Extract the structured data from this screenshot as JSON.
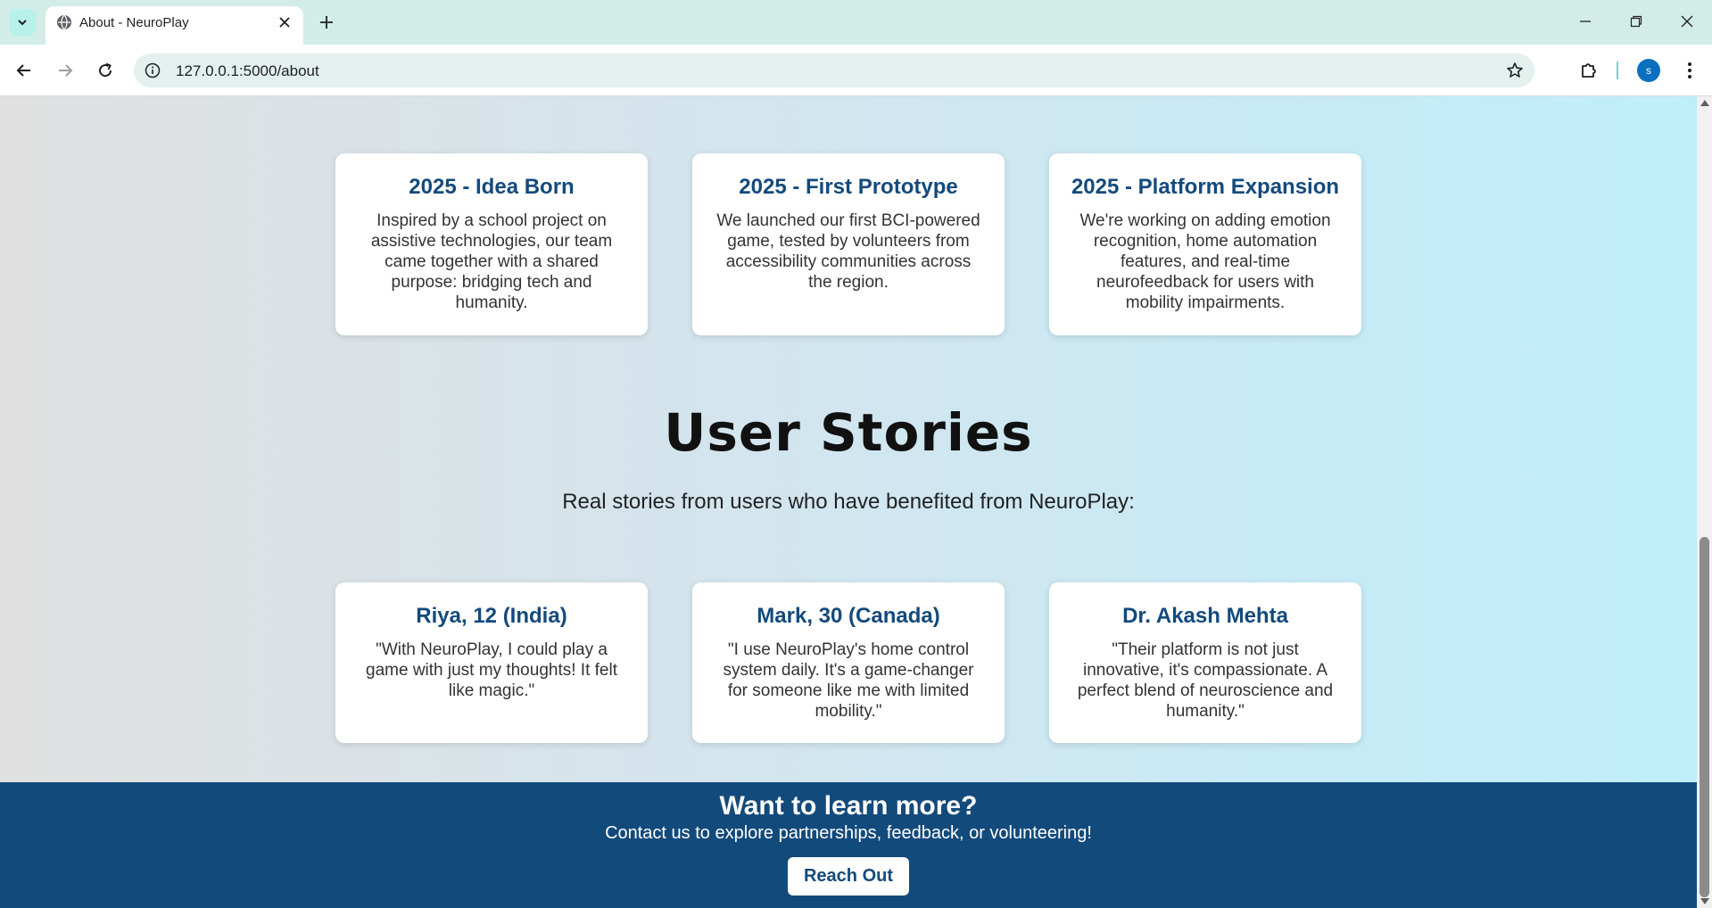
{
  "browser": {
    "tab_title": "About - NeuroPlay",
    "url": "127.0.0.1:5000/about",
    "profile_initial": "s"
  },
  "timeline": [
    {
      "title": "2025 - Idea Born",
      "text": "Inspired by a school project on assistive technologies, our team came together with a shared purpose: bridging tech and humanity."
    },
    {
      "title": "2025 - First Prototype",
      "text": "We launched our first BCI-powered game, tested by volunteers from accessibility communities across the region."
    },
    {
      "title": "2025 - Platform Expansion",
      "text": "We're working on adding emotion recognition, home automation features, and real-time neurofeedback for users with mobility impairments."
    }
  ],
  "user_stories": {
    "heading": "User Stories",
    "subheading": "Real stories from users who have benefited from NeuroPlay:",
    "stories": [
      {
        "name": "Riya, 12 (India)",
        "quote": "\"With NeuroPlay, I could play a game with just my thoughts! It felt like magic.\""
      },
      {
        "name": "Mark, 30 (Canada)",
        "quote": "\"I use NeuroPlay's home control system daily. It's a game-changer for someone like me with limited mobility.\""
      },
      {
        "name": "Dr. Akash Mehta",
        "quote": "\"Their platform is not just innovative, it's compassionate. A perfect blend of neuroscience and humanity.\""
      }
    ]
  },
  "cta": {
    "title": "Want to learn more?",
    "text": "Contact us to explore partnerships, feedback, or volunteering!",
    "button_label": "Reach Out"
  },
  "colors": {
    "primary": "#134a7c",
    "heading": "#111111",
    "text": "#333333"
  }
}
